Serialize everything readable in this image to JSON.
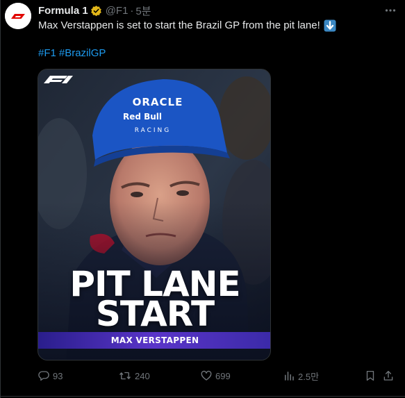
{
  "tweet": {
    "author": {
      "display_name": "Formula 1",
      "handle": "@F1",
      "separator": "·",
      "time": "5분",
      "verified_icon": "verified-gold-badge-icon"
    },
    "text": "Max Verstappen is set to start the Brazil GP from the pit lane!",
    "text_emoji": "down-arrow-emoji-icon",
    "hashtags": [
      "#F1",
      "#BrazilGP"
    ],
    "more_icon": "more-horizontal-icon"
  },
  "media": {
    "headline_line1": "PIT LANE",
    "headline_line2": "START",
    "name_bar": "MAX VERSTAPPEN",
    "cap_brand_line1": "ORACLE",
    "cap_brand_line2": "Red Bull",
    "cap_brand_line3": "RACING",
    "logo_icon": "f1-logo-icon"
  },
  "actions": {
    "reply_count": "93",
    "retweet_count": "240",
    "like_count": "699",
    "views_count": "2.5만",
    "icons": [
      "reply-icon",
      "retweet-icon",
      "like-icon",
      "views-icon",
      "bookmark-icon",
      "share-icon"
    ]
  },
  "colors": {
    "background": "#000000",
    "text_primary": "#e7e9ea",
    "text_secondary": "#71767b",
    "link": "#1d9bf0",
    "f1_red": "#e10600",
    "verified_gold": "#e2b719",
    "name_bar": "#4b2fb8"
  }
}
